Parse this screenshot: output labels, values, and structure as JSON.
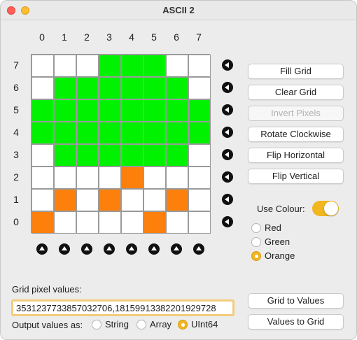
{
  "window": {
    "title": "ASCII 2"
  },
  "grid": {
    "column_labels": [
      "0",
      "1",
      "2",
      "3",
      "4",
      "5",
      "6",
      "7"
    ],
    "row_labels": [
      "7",
      "6",
      "5",
      "4",
      "3",
      "2",
      "1",
      "0"
    ],
    "cells": [
      [
        "white",
        "white",
        "white",
        "green",
        "green",
        "green",
        "white",
        "white"
      ],
      [
        "white",
        "green",
        "green",
        "green",
        "green",
        "green",
        "green",
        "white"
      ],
      [
        "green",
        "green",
        "green",
        "green",
        "green",
        "green",
        "green",
        "green"
      ],
      [
        "green",
        "green",
        "green",
        "green",
        "green",
        "green",
        "green",
        "green"
      ],
      [
        "white",
        "green",
        "green",
        "green",
        "green",
        "green",
        "green",
        "white"
      ],
      [
        "white",
        "white",
        "white",
        "white",
        "orange",
        "white",
        "white",
        "white"
      ],
      [
        "white",
        "orange",
        "white",
        "orange",
        "white",
        "white",
        "orange",
        "white"
      ],
      [
        "orange",
        "white",
        "white",
        "white",
        "white",
        "orange",
        "white",
        "white"
      ]
    ],
    "colors": {
      "white": "#ffffff",
      "green": "#00f200",
      "orange": "#fd7f0c"
    }
  },
  "actions": {
    "fill_grid": "Fill Grid",
    "clear_grid": "Clear Grid",
    "invert_pixels": "Invert Pixels",
    "rotate_clockwise": "Rotate Clockwise",
    "flip_horizontal": "Flip Horizontal",
    "flip_vertical": "Flip Vertical"
  },
  "colour": {
    "use_colour_label": "Use Colour:",
    "use_colour_on": true,
    "options": [
      "Red",
      "Green",
      "Orange"
    ],
    "selected": "Orange"
  },
  "values": {
    "label": "Grid pixel values:",
    "text": "3531237733857032706,18159913382201929728",
    "output_label": "Output values as:",
    "output_options": [
      "String",
      "Array",
      "UInt64"
    ],
    "output_selected": "UInt64",
    "grid_to_values": "Grid to Values",
    "values_to_grid": "Values to Grid"
  }
}
